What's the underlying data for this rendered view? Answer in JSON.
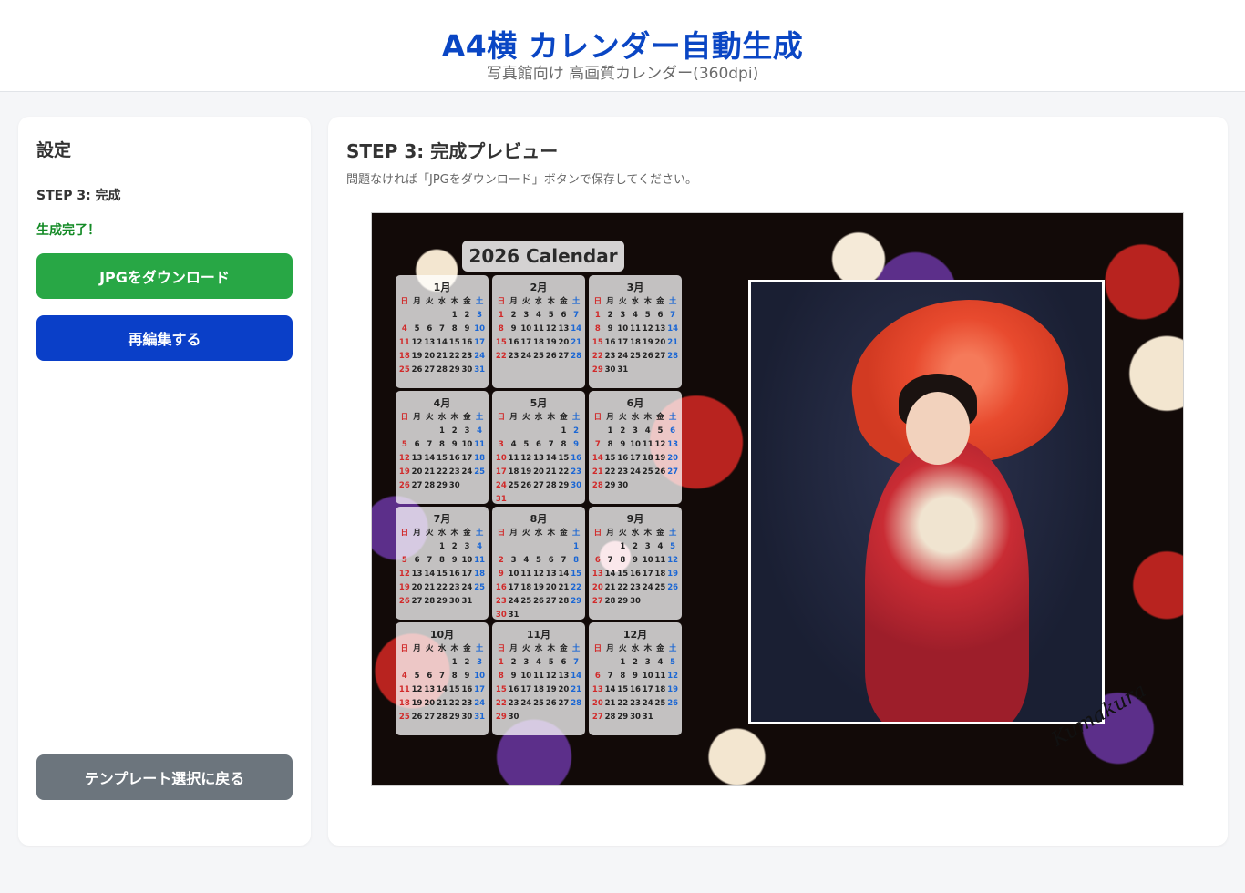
{
  "header": {
    "title": "A4横 カレンダー自動生成",
    "subtitle": "写真館向け 高画質カレンダー(360dpi)"
  },
  "sidebar": {
    "title": "設定",
    "step_label": "STEP 3: 完成",
    "status": "生成完了！",
    "download_label": "JPGをダウンロード",
    "reedit_label": "再編集する",
    "back_label": "テンプレート選択に戻る"
  },
  "main": {
    "title": "STEP 3: 完成プレビュー",
    "description": "問題なければ「JPGをダウンロード」ボタンで保存してください。"
  },
  "calendar": {
    "title": "2026 Calendar",
    "weekdays": [
      "日",
      "月",
      "火",
      "水",
      "木",
      "金",
      "土"
    ],
    "months": [
      {
        "name": "1月",
        "start": 4,
        "days": 31
      },
      {
        "name": "2月",
        "start": 0,
        "days": 28
      },
      {
        "name": "3月",
        "start": 0,
        "days": 31
      },
      {
        "name": "4月",
        "start": 3,
        "days": 30
      },
      {
        "name": "5月",
        "start": 5,
        "days": 31
      },
      {
        "name": "6月",
        "start": 1,
        "days": 30
      },
      {
        "name": "7月",
        "start": 3,
        "days": 31
      },
      {
        "name": "8月",
        "start": 6,
        "days": 31
      },
      {
        "name": "9月",
        "start": 2,
        "days": 30
      },
      {
        "name": "10月",
        "start": 4,
        "days": 31
      },
      {
        "name": "11月",
        "start": 0,
        "days": 30
      },
      {
        "name": "12月",
        "start": 2,
        "days": 31
      }
    ],
    "signature": "Kumakura"
  },
  "colors": {
    "title_blue": "#0a46c4",
    "download_green": "#28a745",
    "reedit_blue": "#0a3fc8",
    "back_gray": "#6c757d",
    "status_green": "#138a25",
    "sunday_red": "#d12a2a",
    "saturday_blue": "#1a66d4"
  }
}
